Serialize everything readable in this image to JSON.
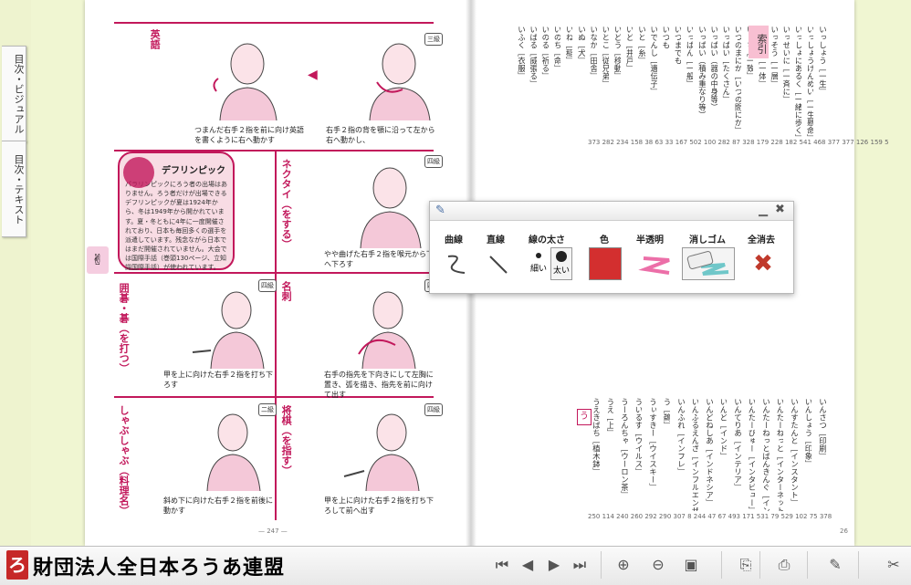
{
  "left_tabs": [
    {
      "label": "目次・ビジュアル"
    },
    {
      "label": "目次・テキスト"
    }
  ],
  "left_page": {
    "cells": [
      {
        "word": "英語",
        "badge": "三級",
        "caption1": "つまんだ右手２指を前に向け英語を書くように右へ動かす",
        "caption2": "右手２指の背を顎に沿って左から右へ動かし、"
      },
      {
        "word": "ネクタイ（をする）",
        "badge": "四級",
        "caption": "やや曲げた右手２指を喉元から下へ下ろす"
      },
      {
        "word": "囲碁・碁（を打つ）",
        "badge": "四級",
        "caption": "甲を上に向けた右手２指を打ち下ろす"
      },
      {
        "word": "名刺",
        "badge": "四級",
        "caption": "右手の指先を下向きにして左胸に置き、弧を描き、指先を前に向けて出す"
      },
      {
        "word": "しゃぶしゃぶ（料理名）",
        "badge": "二級",
        "caption": "斜め下に向けた右手２指を前後に動かす"
      },
      {
        "word": "将棋（を指す）",
        "badge": "四級",
        "caption": "甲を上に向けた右手２指を打ち下ろして前へ出す"
      }
    ],
    "infobox": {
      "title": "デフリンピック",
      "text": "パラリンピックにろう者の出場はありません。ろう者だけが出場できるデフリンピックが夏は1924年から、冬は1949年から開かれています。夏・冬ともに4年に一度開催されており、日本も毎回多くの選手を派遣しています。残念ながら日本ではまだ開催されていません。大会では国際手話（巻頭130ページ、立知識国際手話）が使われています。"
    },
    "page_number": "— 247 —"
  },
  "right_page": {
    "index_tab": "索引",
    "columns_top": [
      "いっしょう［一生］",
      "いっしょうけんめい［一生懸命］",
      "いっしょにあるく［一緒に歩く］",
      "いっせいに［一斉に］",
      "いっそう［一層］",
      "いったい［一体］",
      "いっち［一致］",
      "いつのまにか［いつの間にか］",
      "いっぱい［たくさん］",
      "いっぱい（器の中身等）",
      "いっぱい（積み重なり等）",
      "いっぱん［一般］",
      "いつまでも",
      "いつも",
      "いでんし［遺伝子］",
      "いと［糸］",
      "いど［井戸］",
      "いどう［移動］",
      "いとこ［従兄弟］",
      "いなか［田舎］",
      "いぬ［犬］",
      "いね［稲］",
      "いのち［命］",
      "いのる［祈る］",
      "いばる［威張る］",
      "いふく［衣服］"
    ],
    "columns_bottom": [
      "いんさつ［印刷］",
      "いんしょう［印象］",
      "いんすたんと［インスタント］",
      "いんたーねっと［インターネット］",
      "いんたーねっとばんきんぐ［インターネットバンキング］",
      "いんたーびゅー［インタビュー］",
      "いんてりあ［インテリア］",
      "いんど［インド］",
      "いんどねしあ［インドネシア］",
      "いんふるえんざ［インフルエンザ］",
      "いんふれ［インフレ］",
      "う［鵜］",
      "うぃすきー［ウイスキー］",
      "ういるす［ウイルス］",
      "うーろんちゃ［ウーロン茶］",
      "うえ［上］",
      "うえきばち［植木鉢］"
    ],
    "section_head": "う",
    "numbers_top": "373 282 234 158 38 63 33 167 502 100 282 87 328 179 228 182 541 468 377 377 126 159 539 270 364 239",
    "numbers_bottom": "250 114 240 260 292 290 307 8 244 47 67 493 171 531 79 529 102 75 378",
    "page_number": "26"
  },
  "palette": {
    "tools": [
      {
        "label": "曲線",
        "icon": "curve-icon"
      },
      {
        "label": "直線",
        "icon": "line-icon"
      },
      {
        "label": "線の太さ",
        "icon": "thickness-icon",
        "thin": "細い",
        "thick": "太い"
      },
      {
        "label": "色",
        "icon": "color-icon"
      },
      {
        "label": "半透明",
        "icon": "highlighter-icon"
      },
      {
        "label": "消しゴム",
        "icon": "eraser-icon"
      },
      {
        "label": "全消去",
        "icon": "clear-all-icon"
      }
    ],
    "selected_color": "#d32f2f",
    "highlight_color": "#ec6fa8",
    "accent_color": "#6fc7c9"
  },
  "toolbar": {
    "logo_mark": "ろ",
    "logo_text": "財団法人全日本ろうあ連盟",
    "buttons": [
      {
        "icon": "first-page-icon",
        "glyph": "⏮"
      },
      {
        "icon": "prev-page-icon",
        "glyph": "◀"
      },
      {
        "icon": "next-page-icon",
        "glyph": "▶"
      },
      {
        "icon": "last-page-icon",
        "glyph": "⏭"
      },
      {
        "icon": "zoom-in-icon",
        "glyph": "⊕"
      },
      {
        "icon": "zoom-out-icon",
        "glyph": "⊖"
      },
      {
        "icon": "page-view-icon",
        "glyph": "▣"
      },
      {
        "icon": "export-icon",
        "glyph": "⎘"
      },
      {
        "icon": "print-icon",
        "glyph": "⎙"
      },
      {
        "icon": "pen-icon",
        "glyph": "✎"
      },
      {
        "icon": "scissors-icon",
        "glyph": "✂"
      }
    ]
  }
}
